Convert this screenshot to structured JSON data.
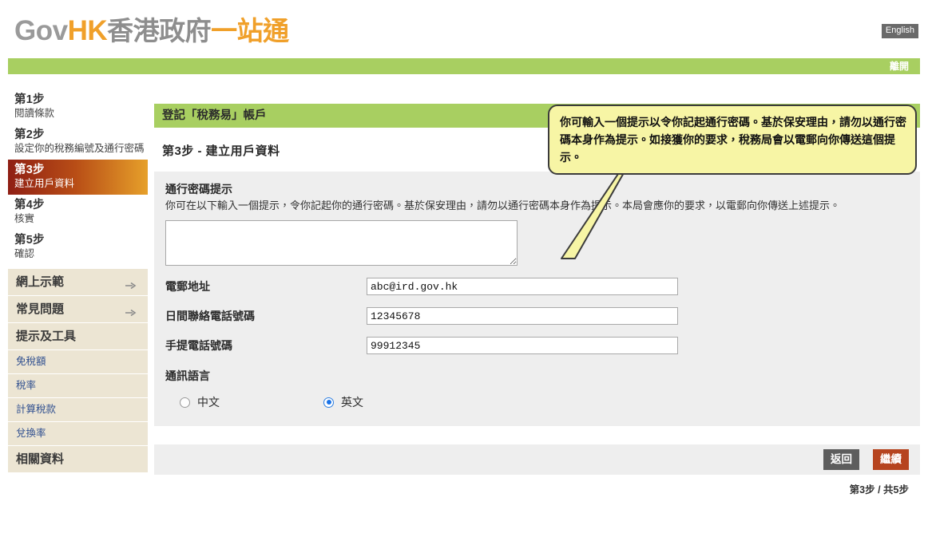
{
  "header": {
    "logo_gov": "Gov",
    "logo_hk": "HK",
    "logo_cn_gray": "香港政府",
    "logo_cn_orange": "一站通",
    "english_button": "English",
    "leave_button": "離開"
  },
  "sidebar": {
    "steps": [
      {
        "num": "第1步",
        "desc": "閱讀條款",
        "active": false
      },
      {
        "num": "第2步",
        "desc": "設定你的稅務編號及通行密碼",
        "active": false
      },
      {
        "num": "第3步",
        "desc": "建立用戶資料",
        "active": true
      },
      {
        "num": "第4步",
        "desc": "核實",
        "active": false
      },
      {
        "num": "第5步",
        "desc": "確認",
        "active": false
      }
    ],
    "sections": [
      {
        "label": "網上示範",
        "arrow": true
      },
      {
        "label": "常見問題",
        "arrow": true
      },
      {
        "label": "提示及工具",
        "arrow": false
      }
    ],
    "links": [
      "免稅額",
      "稅率",
      "計算稅款",
      "兌換率"
    ],
    "last_section": "相關資料"
  },
  "main": {
    "title": "登記「稅務易」帳戶",
    "step_heading": "第3步  -  建立用戶資料",
    "password_hint": {
      "label": "通行密碼提示",
      "description": "你可在以下輸入一個提示，令你記起你的通行密碼。基於保安理由，請勿以通行密碼本身作為提示。本局會應你的要求，以電郵向你傳送上述提示。",
      "value": "",
      "placeholder": ""
    },
    "fields": [
      {
        "label": "電郵地址",
        "value": "abc@ird.gov.hk",
        "name": "email-field"
      },
      {
        "label": "日間聯絡電話號碼",
        "value": "12345678",
        "name": "daytime-phone-field"
      },
      {
        "label": "手提電話號碼",
        "value": "99912345",
        "name": "mobile-phone-field"
      }
    ],
    "language": {
      "heading": "通訊語言",
      "options": [
        {
          "label": "中文",
          "selected": false
        },
        {
          "label": "英文",
          "selected": true
        }
      ]
    },
    "buttons": {
      "back": "返回",
      "next": "繼續"
    },
    "progress": "第3步 / 共5步"
  },
  "callout": {
    "text": "你可輸入一個提示以令你記起通行密碼。基於保安理由，請勿以通行密碼本身作為提示。如接獲你的要求，稅務局會以電郵向你傳送這個提示。"
  },
  "colors": {
    "green": "#a8cf61",
    "orange": "#f0a02a",
    "accent_red": "#b6441f",
    "callout_bg": "#f7f5a5",
    "sidebar_bg": "#ece5d3"
  }
}
